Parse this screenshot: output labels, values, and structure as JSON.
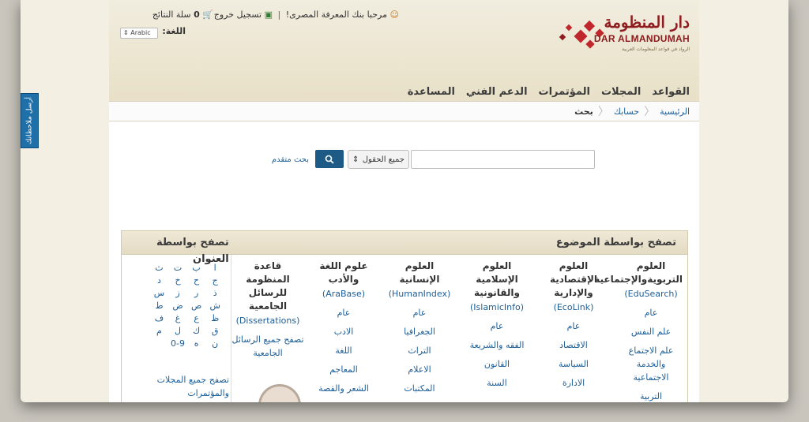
{
  "feedback": {
    "label": "أرسل ملاحظاتك"
  },
  "logo": {
    "arabic": "دار المنظومة",
    "english": "DAR ALMANDUMAH",
    "tagline": "الرواد في قواعد المعلومات العربية",
    "colors": {
      "red": "#c0272d",
      "dark": "#8e1b1d"
    }
  },
  "top": {
    "welcome": "مرحبا بنك المعرفة المصرى!",
    "separator": "|",
    "logout": "تسجيل خروج",
    "cart_count": "0",
    "cart_label": "سلة النتائج",
    "lang_label": "اللغة:",
    "lang_value": "Arabic"
  },
  "nav": [
    "القواعد",
    "المجلات",
    "المؤتمرات",
    "الدعم الفني",
    "المساعدة"
  ],
  "breadcrumb": {
    "home": "الرئيسية",
    "account": "حسابك",
    "current": "بحث"
  },
  "search": {
    "field_value": "جميع الحقول",
    "button_icon": "search-icon",
    "advanced": "بحث متقدم"
  },
  "browse": {
    "by_subject": "تصفح بواسطة الموضوع",
    "by_title": "تصفح بواسطة",
    "title_word": "العنوان",
    "columns": [
      {
        "title": "العلوم التربويةوالإجتماعية",
        "code": "(EduSearch)",
        "links": [
          "عام",
          "علم النفس",
          "علم الاجتماع والخدمة الاجتماعية",
          "التربية"
        ]
      },
      {
        "title": "العلوم الإقتصادية والإدارية",
        "code": "(EcoLink)",
        "links": [
          "عام",
          "الاقتصاد",
          "السياسة",
          "الادارة"
        ]
      },
      {
        "title": "العلوم الإسلامية والقانونية",
        "code": "(IslamicInfo)",
        "links": [
          "عام",
          "الفقه والشريعة",
          "القانون",
          "السنة"
        ]
      },
      {
        "title": "العلوم الإنسانية",
        "code": "(HumanIndex)",
        "links": [
          "عام",
          "الجغرافيا",
          "التراث",
          "الاعلام",
          "المكتبات"
        ]
      },
      {
        "title": "علوم اللغة والأدب",
        "code": "(AraBase)",
        "links": [
          "عام",
          "الادب",
          "اللغة",
          "المعاجم",
          "الشعر والقصة"
        ]
      },
      {
        "title": "قاعدة المنظومة للرسائل الجامعية",
        "code": "(Dissertations)",
        "links": [
          "تصفح جميع الرسائل الجامعية"
        ]
      }
    ],
    "letters": [
      "ا",
      "ب",
      "ت",
      "ث",
      "ج",
      "ح",
      "خ",
      "د",
      "ذ",
      "ر",
      "ز",
      "س",
      "ش",
      "ص",
      "ض",
      "ط",
      "ظ",
      "ع",
      "غ",
      "ف",
      "ق",
      "ك",
      "ل",
      "م",
      "ن",
      "ه",
      "0-9"
    ],
    "browse_all": "تصفح جميع المجلات والمؤتمرات"
  }
}
